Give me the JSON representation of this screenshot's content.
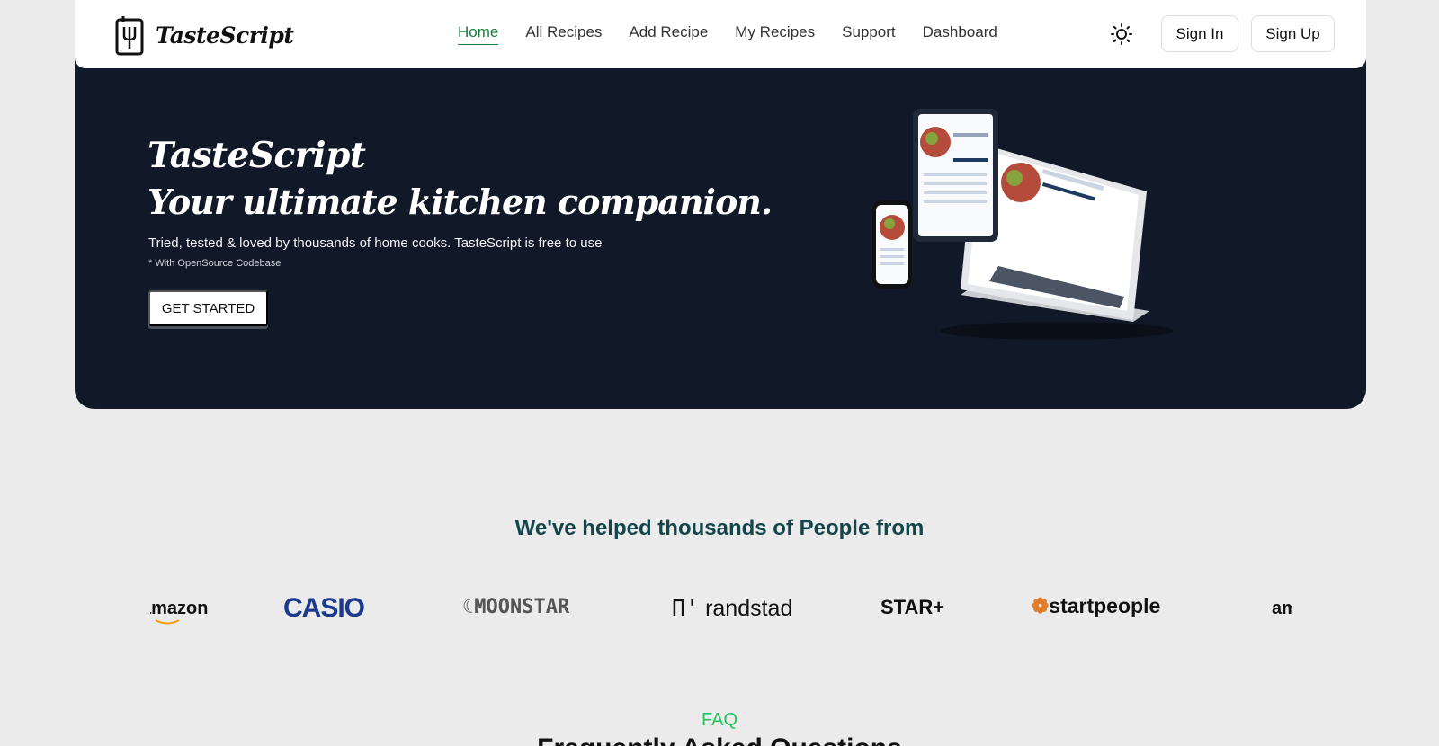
{
  "nav": {
    "brand": "TasteScript",
    "links": [
      "Home",
      "All Recipes",
      "Add Recipe",
      "My Recipes",
      "Support",
      "Dashboard"
    ],
    "sign_in": "Sign In",
    "sign_up": "Sign Up",
    "theme_icon": "sun-icon"
  },
  "hero": {
    "title": "TasteScript",
    "tagline": "Your ultimate kitchen companion.",
    "subtitle": "Tried, tested & loved by thousands of home cooks. TasteScript is free to use",
    "note": "* With OpenSource Codebase",
    "cta": "GET STARTED"
  },
  "clients": {
    "heading": "We've helped thousands of People from",
    "logos": [
      "amazon",
      "CASIO",
      "MOONSTAR",
      "randstad",
      "STAR+",
      "startpeople",
      "amazon"
    ]
  },
  "faq": {
    "label": "FAQ",
    "title": "Frequently Asked Questions"
  },
  "colors": {
    "hero_bg": "#111827",
    "accent_green": "#15803d",
    "faq_green": "#22c55e",
    "heading_teal": "#13454a",
    "casio_blue": "#1a3a8f",
    "startpeople_orange": "#e07b2a"
  }
}
